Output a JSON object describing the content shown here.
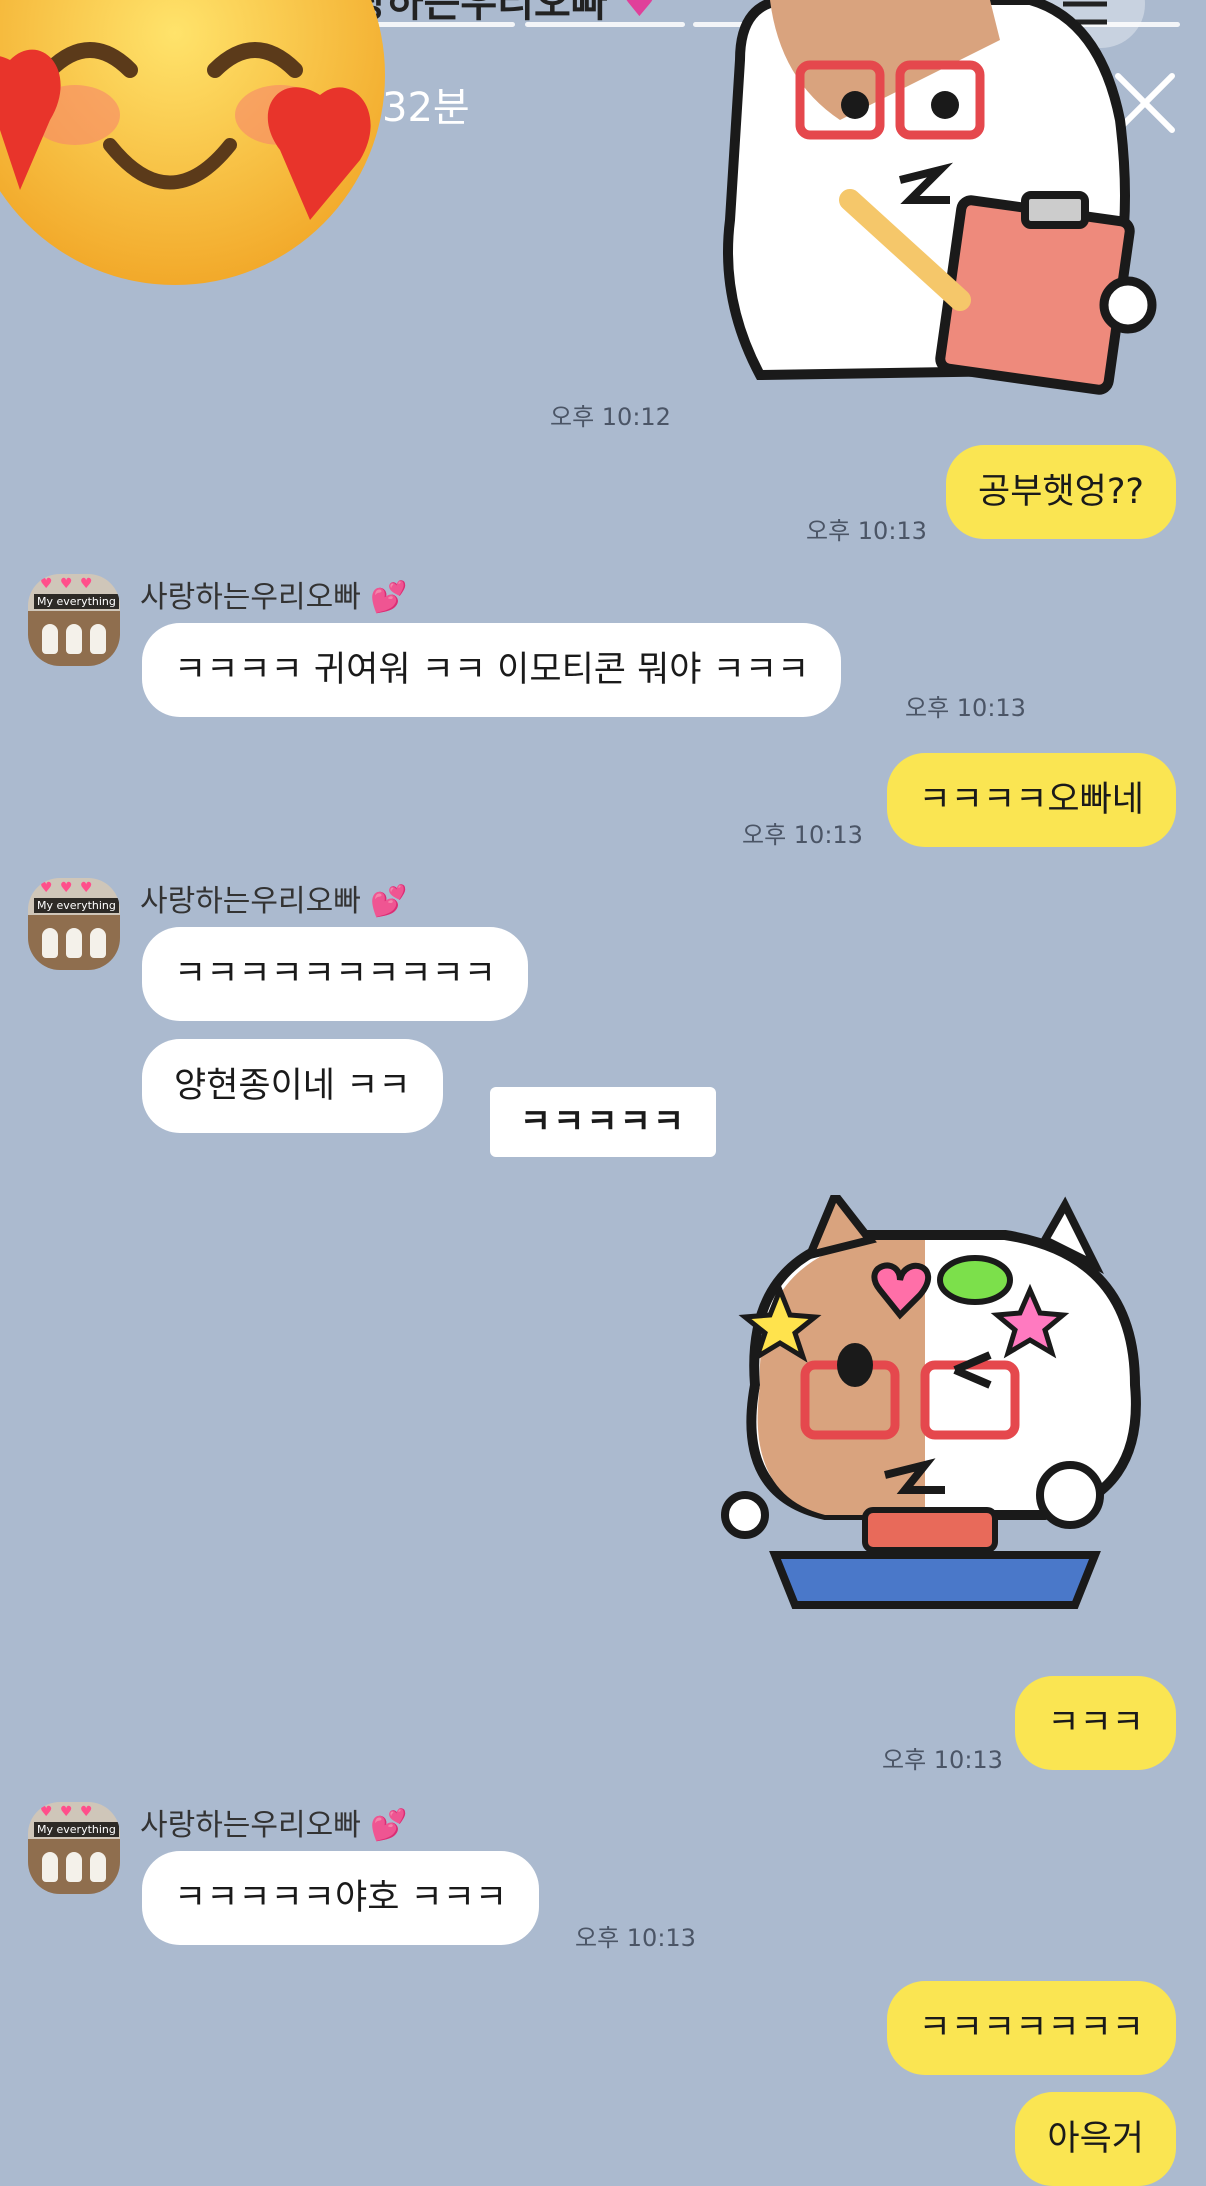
{
  "story": {
    "title_fragment": "랑하는우리오빠",
    "elapsed": "32분",
    "more_label": "···"
  },
  "messages": {
    "t1": "오후 10:12",
    "m1": {
      "text": "공부햇엉??",
      "time": "오후 10:13"
    },
    "m2": {
      "sender": "사랑하는우리오빠",
      "text": "ㅋㅋㅋㅋ 귀여워 ㅋㅋ 이모티콘 뭐야 ㅋㅋㅋ",
      "time": "오후 10:13"
    },
    "m3": {
      "text": "ㅋㅋㅋㅋ오빠네",
      "time": "오후 10:13"
    },
    "m4": {
      "sender": "사랑하는우리오빠",
      "text": "ㅋㅋㅋㅋㅋㅋㅋㅋㅋㅋ",
      "text2": "양현종이네 ㅋㅋ"
    },
    "overlay_text": "ㅋㅋㅋㅋㅋ",
    "m5": {
      "text": "ㅋㅋㅋ",
      "time": "오후 10:13"
    },
    "m6": {
      "sender": "사랑하는우리오빠",
      "text": "ㅋㅋㅋㅋㅋ야호 ㅋㅋㅋ",
      "time": "오후 10:13"
    },
    "m7": {
      "text": "ㅋㅋㅋㅋㅋㅋㅋ"
    },
    "m8": {
      "text": "아윽거"
    },
    "avatar_banner": "My everything"
  },
  "colors": {
    "background": "#abbacf",
    "outgoing_bubble": "#fae552",
    "incoming_bubble": "#ffffff"
  },
  "icons": [
    "smiling-face-with-hearts-emoji",
    "search-icon",
    "phone-icon",
    "menu-icon",
    "more-icon",
    "close-icon",
    "heart-emoji"
  ]
}
